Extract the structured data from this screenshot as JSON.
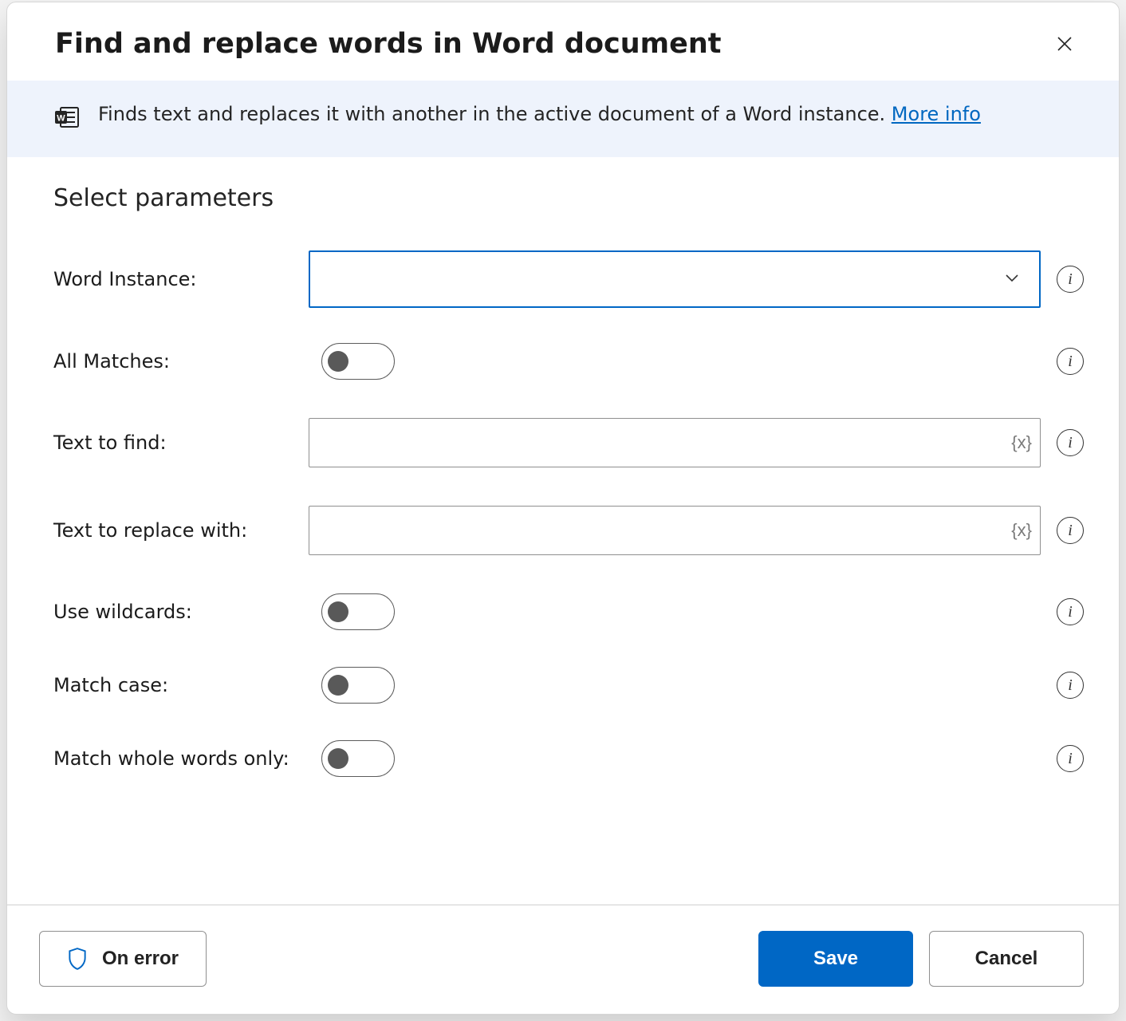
{
  "dialog": {
    "title": "Find and replace words in Word document",
    "description": "Finds text and replaces it with another in the active document of a Word instance. ",
    "more_info_label": "More info"
  },
  "section": {
    "title": "Select parameters"
  },
  "fields": {
    "word_instance": {
      "label": "Word Instance:",
      "value": ""
    },
    "all_matches": {
      "label": "All Matches:",
      "on": false
    },
    "text_to_find": {
      "label": "Text to find:",
      "value": "",
      "var_hint": "{x}"
    },
    "text_to_replace": {
      "label": "Text to replace with:",
      "value": "",
      "var_hint": "{x}"
    },
    "use_wildcards": {
      "label": "Use wildcards:",
      "on": false
    },
    "match_case": {
      "label": "Match case:",
      "on": false
    },
    "match_whole": {
      "label": "Match whole words only:",
      "on": false
    }
  },
  "footer": {
    "on_error_label": "On error",
    "save_label": "Save",
    "cancel_label": "Cancel"
  },
  "icons": {
    "word": "word-app-icon",
    "info": "i"
  }
}
